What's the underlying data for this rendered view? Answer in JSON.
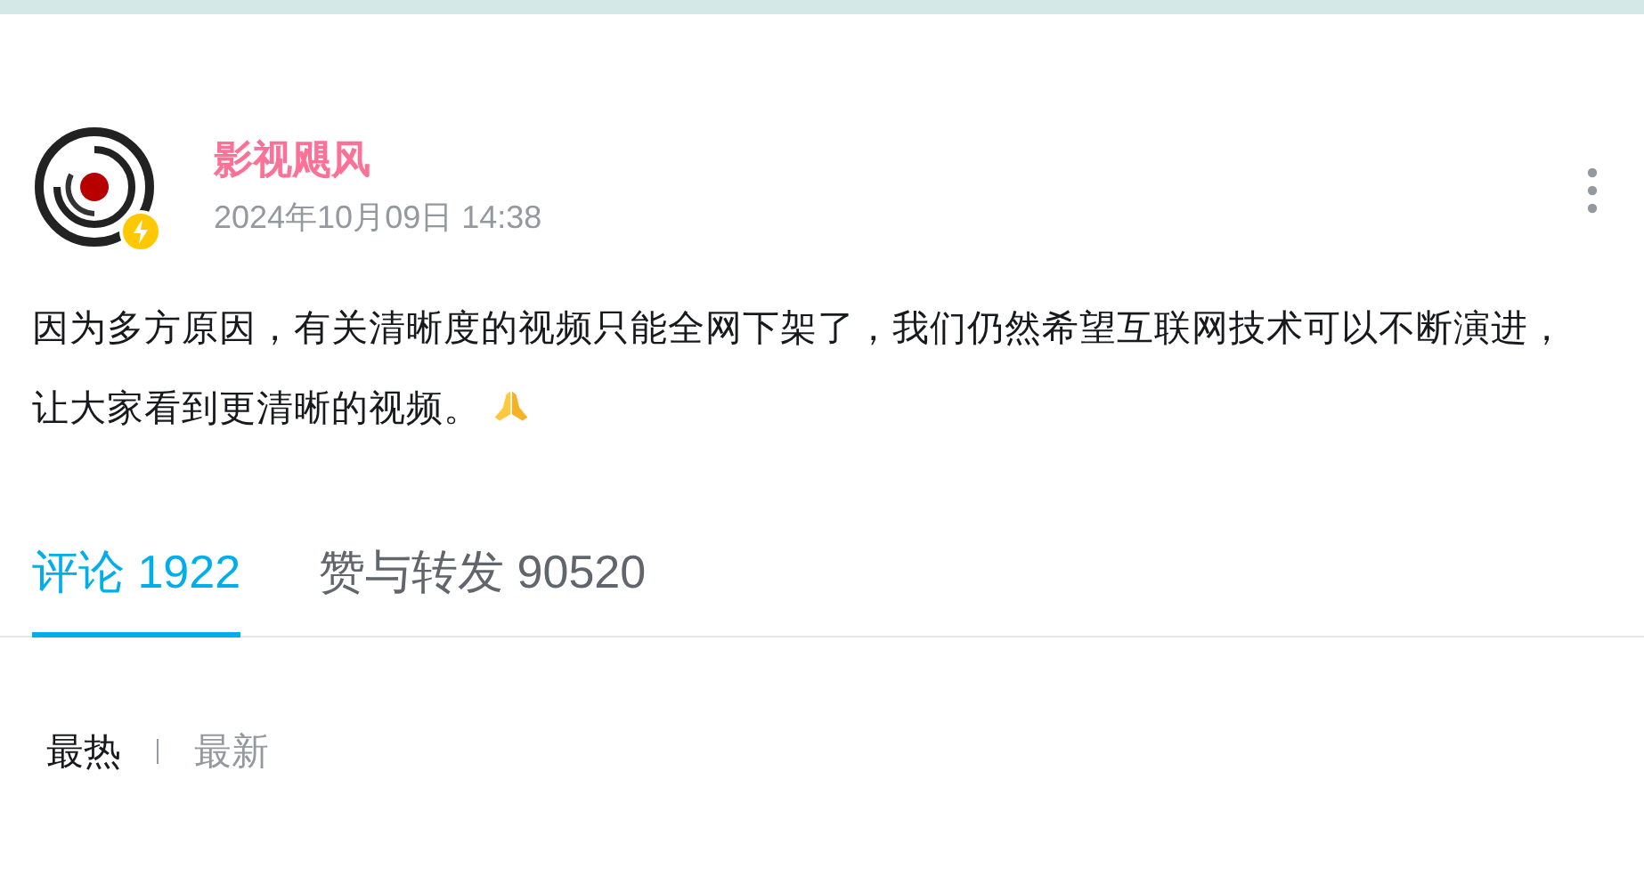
{
  "post": {
    "author": "影视飓风",
    "verified": true,
    "time": "2024年10月09日 14:38",
    "text": "因为多方原因，有关清晰度的视频只能全网下架了，我们仍然希望互联网技术可以不断演进，让大家看到更清晰的视频。"
  },
  "tabs": [
    {
      "label": "评论 1922",
      "selected": true
    },
    {
      "label": "赞与转发 90520",
      "selected": false
    }
  ],
  "sort": [
    {
      "label": "最热",
      "selected": true
    },
    {
      "label": "最新",
      "selected": false
    }
  ]
}
